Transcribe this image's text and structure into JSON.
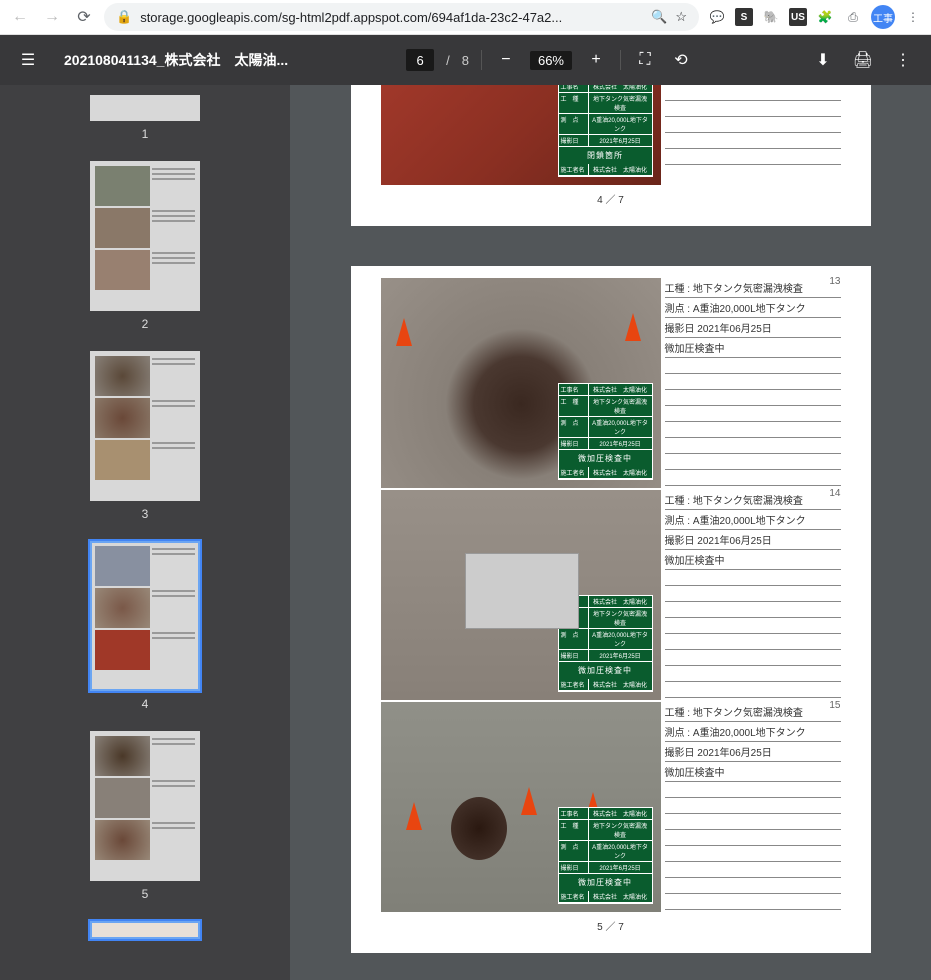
{
  "browser": {
    "url": "storage.googleapis.com/sg-html2pdf.appspot.com/694af1da-23c2-47a2...",
    "avatar": "工事"
  },
  "pdf": {
    "title": "202108041134_株式会社　太陽油...",
    "current_page": "6",
    "total_pages": "8",
    "zoom": "66%"
  },
  "thumbs": [
    {
      "num": "1"
    },
    {
      "num": "2"
    },
    {
      "num": "3"
    },
    {
      "num": "4"
    },
    {
      "num": "5"
    }
  ],
  "page4_footer": "4 ／ 7",
  "page5_footer": "5 ／ 7",
  "overlay": {
    "l1": "工事名",
    "v1": "株式会社　太陽油化",
    "l2": "工　種",
    "v2": "地下タンク気密漏洩検査",
    "l3": "測　点",
    "v3": "A重油20,000L地下タンク",
    "l4": "撮影日",
    "v4": "2021年6月25日",
    "status12": "閉鎖箇所",
    "status": "微加圧検査中",
    "l5": "施工者名",
    "v5": "株式会社　太陽油化"
  },
  "items": [
    {
      "num": "13",
      "l1": "工種 : 地下タンク気密漏洩検査",
      "l2": "測点 : A重油20,000L地下タンク",
      "l3": "撮影日 2021年06月25日",
      "l4": "微加圧検査中"
    },
    {
      "num": "14",
      "l1": "工種 : 地下タンク気密漏洩検査",
      "l2": "測点 : A重油20,000L地下タンク",
      "l3": "撮影日 2021年06月25日",
      "l4": "微加圧検査中"
    },
    {
      "num": "15",
      "l1": "工種 : 地下タンク気密漏洩検査",
      "l2": "測点 : A重油20,000L地下タンク",
      "l3": "撮影日 2021年06月25日",
      "l4": "微加圧検査中"
    }
  ]
}
